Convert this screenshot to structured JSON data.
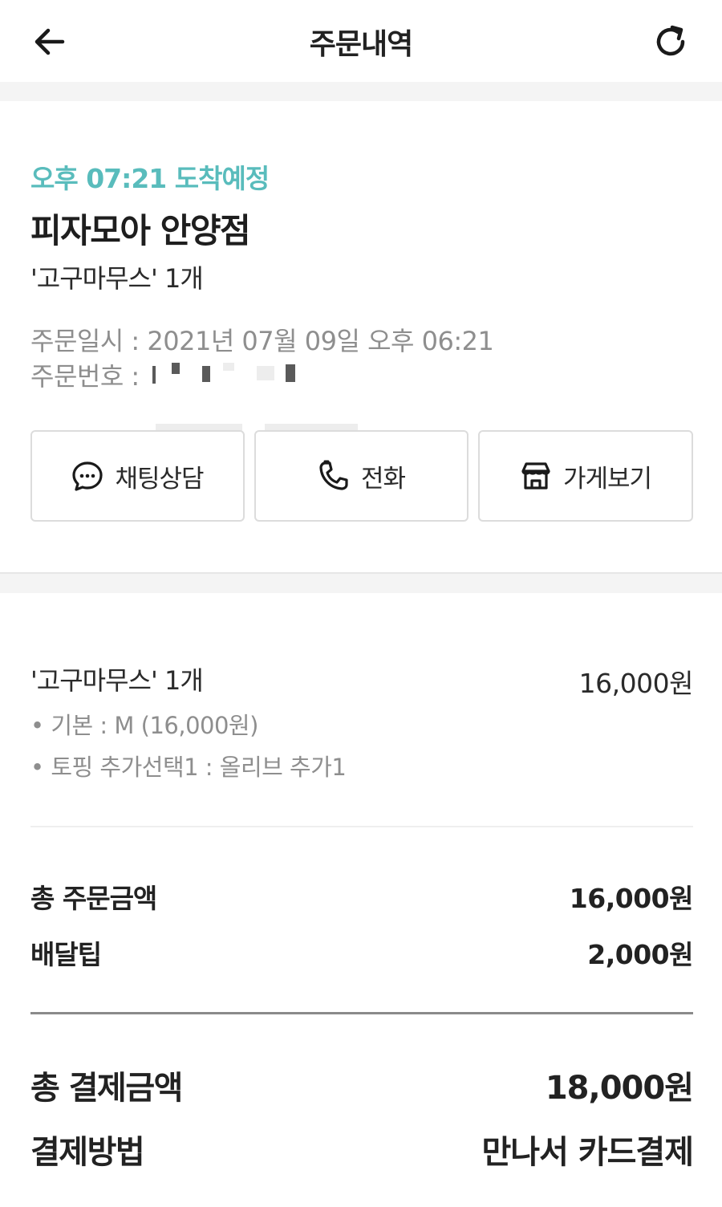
{
  "header": {
    "title": "주문내역",
    "back_icon": "arrow-left-icon",
    "refresh_icon": "refresh-icon"
  },
  "order": {
    "eta": "오후 07:21 도착예정",
    "store_name": "피자모아 안양점",
    "summary": "'고구마무스' 1개",
    "order_date": "주문일시 : 2021년 07월 09일 오후 06:21",
    "order_number_label": "주문번호 : "
  },
  "actions": [
    {
      "label": "채팅상담",
      "icon": "chat-bubble-icon"
    },
    {
      "label": "전화",
      "icon": "phone-icon"
    },
    {
      "label": "가게보기",
      "icon": "store-icon"
    }
  ],
  "item": {
    "name": "'고구마무스' 1개",
    "price": "16,000원",
    "options": [
      "• 기본 : M (16,000원)",
      "• 토핑 추가선택1 : 올리브 추가1"
    ]
  },
  "totals": {
    "order_amount_label": "총 주문금액",
    "order_amount": "16,000원",
    "delivery_tip_label": "배달팁",
    "delivery_tip": "2,000원",
    "payment_total_label": "총 결제금액",
    "payment_total": "18,000원",
    "payment_method_label": "결제방법",
    "payment_method": "만나서 카드결제"
  },
  "colors": {
    "accent": "#59bcbc",
    "text": "#1e1e1e",
    "muted": "#8e8e8e",
    "band": "#f4f4f4"
  }
}
